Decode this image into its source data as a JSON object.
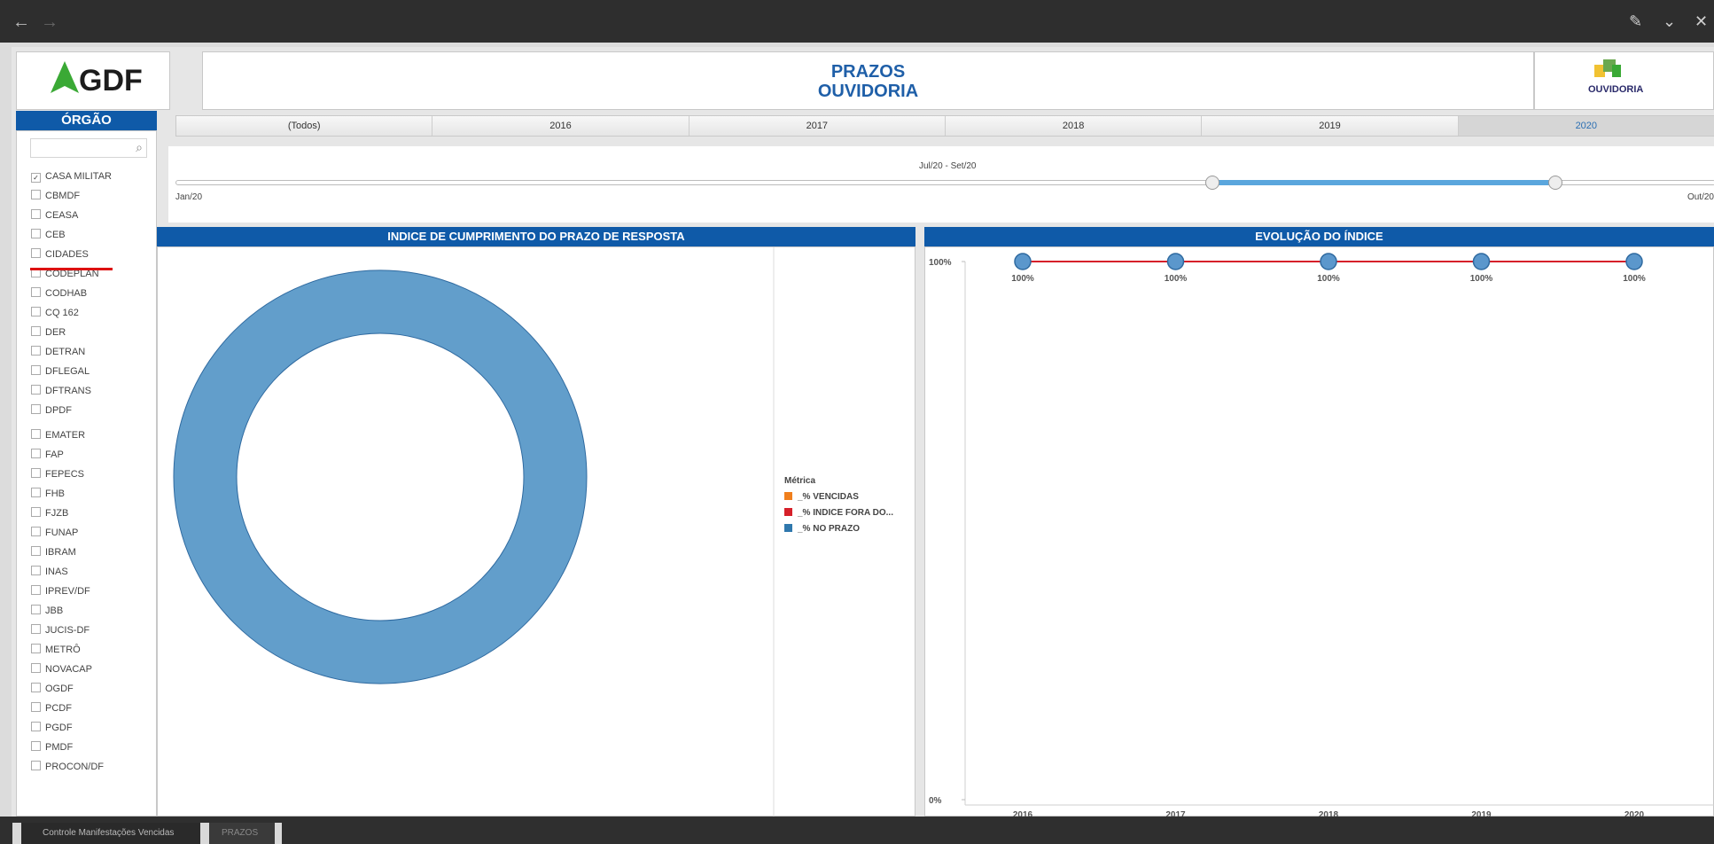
{
  "window": {
    "back_glyph": "←",
    "forward_glyph": "→",
    "edit_glyph": "✎",
    "minimize_glyph": "⌄",
    "close_glyph": "✕"
  },
  "header": {
    "gdf_logo_text": "GDF",
    "title_line1": "PRAZOS",
    "title_line2": "OUVIDORIA",
    "ouvidoria_logo_text": "OUVIDORIA"
  },
  "sidebar": {
    "title": "ÓRGÃO",
    "search_icon": "⌕",
    "items": [
      {
        "label": "CASA MILITAR",
        "checked": true
      },
      {
        "label": "CBMDF",
        "checked": false
      },
      {
        "label": "CEASA",
        "checked": false
      },
      {
        "label": "CEB",
        "checked": false
      },
      {
        "label": "CIDADES",
        "checked": false
      },
      {
        "label": "CODEPLAN",
        "checked": false
      },
      {
        "label": "CODHAB",
        "checked": false
      },
      {
        "label": "CQ 162",
        "checked": false
      },
      {
        "label": "DER",
        "checked": false
      },
      {
        "label": "DETRAN",
        "checked": false
      },
      {
        "label": "DFLEGAL",
        "checked": false
      },
      {
        "label": "DFTRANS",
        "checked": false
      },
      {
        "label": "DPDF",
        "checked": false
      },
      {
        "label": "EMATER",
        "checked": false
      },
      {
        "label": "FAP",
        "checked": false
      },
      {
        "label": "FEPECS",
        "checked": false
      },
      {
        "label": "FHB",
        "checked": false
      },
      {
        "label": "FJZB",
        "checked": false
      },
      {
        "label": "FUNAP",
        "checked": false
      },
      {
        "label": "IBRAM",
        "checked": false
      },
      {
        "label": "INAS",
        "checked": false
      },
      {
        "label": "IPREV/DF",
        "checked": false
      },
      {
        "label": "JBB",
        "checked": false
      },
      {
        "label": "JUCIS-DF",
        "checked": false
      },
      {
        "label": "METRÔ",
        "checked": false
      },
      {
        "label": "NOVACAP",
        "checked": false
      },
      {
        "label": "OGDF",
        "checked": false
      },
      {
        "label": "PCDF",
        "checked": false
      },
      {
        "label": "PGDF",
        "checked": false
      },
      {
        "label": "PMDF",
        "checked": false
      },
      {
        "label": "PROCON/DF",
        "checked": false
      }
    ]
  },
  "year_filter": {
    "options": [
      "(Todos)",
      "2016",
      "2017",
      "2018",
      "2019",
      "2020"
    ],
    "selected": "2020"
  },
  "period_slider": {
    "range_label": "Jul/20 - Set/20",
    "min_label": "Jan/20",
    "max_label": "Out/20"
  },
  "donut_panel": {
    "title": "INDICE DE CUMPRIMENTO DO PRAZO DE RESPOSTA",
    "legend_title": "Métrica",
    "legend": [
      {
        "label": "_% VENCIDAS",
        "color": "#f07f1d"
      },
      {
        "label": "_% INDICE FORA DO...",
        "color": "#d6202a"
      },
      {
        "label": "_% NO PRAZO",
        "color": "#2f78ad"
      }
    ]
  },
  "line_panel": {
    "title": "EVOLUÇÃO DO ÍNDICE"
  },
  "chart_data": [
    {
      "type": "pie",
      "title": "INDICE DE CUMPRIMENTO DO PRAZO DE RESPOSTA",
      "categories": [
        "_% VENCIDAS",
        "_% INDICE FORA DO...",
        "_% NO PRAZO"
      ],
      "values": [
        0,
        0,
        100
      ],
      "donut": true,
      "legend": "right"
    },
    {
      "type": "line",
      "title": "EVOLUÇÃO DO ÍNDICE",
      "categories": [
        "2016",
        "2017",
        "2018",
        "2019",
        "2020"
      ],
      "values": [
        100,
        100,
        100,
        100,
        100
      ],
      "data_labels": [
        "100%",
        "100%",
        "100%",
        "100%",
        "100%"
      ],
      "y_tick_labels": [
        "100%",
        "0%"
      ],
      "ylim": [
        0,
        100
      ],
      "line_color": "#d6202a",
      "marker_color": "#5b97cc",
      "grid": false
    }
  ],
  "bottom_tabs": [
    {
      "label": "Controle Manifestações Vencidas",
      "active": true
    },
    {
      "label": "PRAZOS",
      "active": false
    }
  ],
  "colors": {
    "brand_blue": "#0f5aa8",
    "donut_fill": "#629ecb",
    "donut_stroke": "#2f6aa0",
    "gdf_green": "#3aa935",
    "selection_red": "#d11111"
  }
}
